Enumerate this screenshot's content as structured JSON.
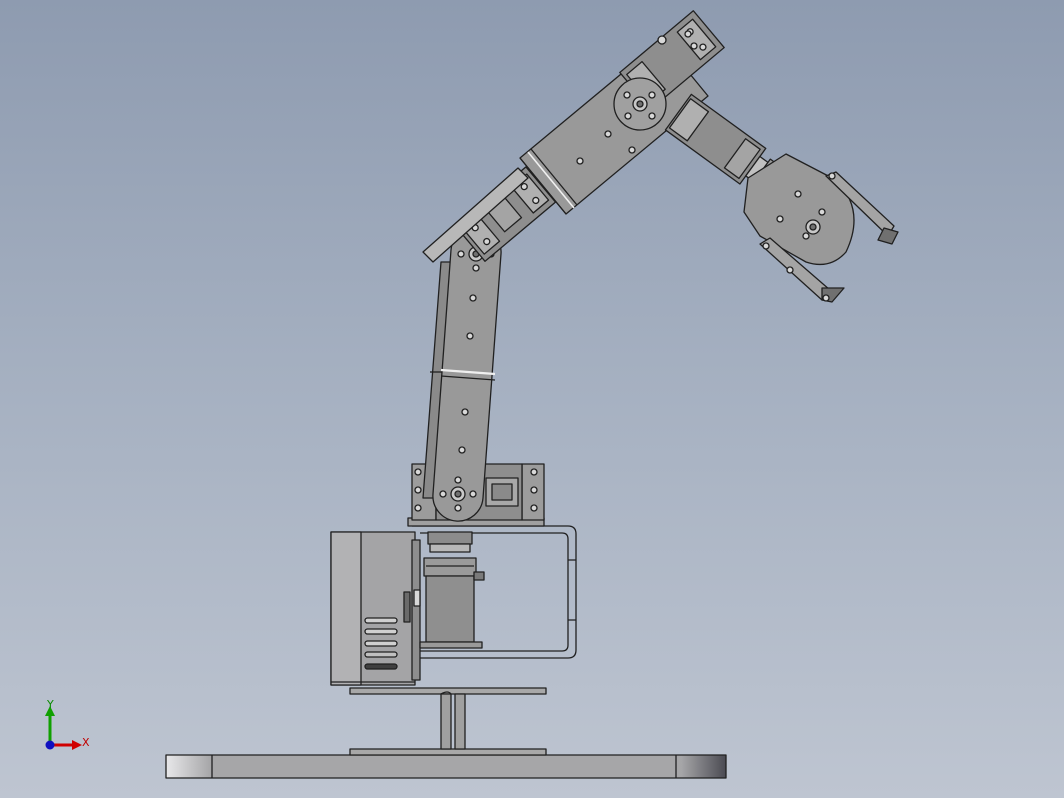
{
  "view": {
    "background_top": "#8e9bb0",
    "background_bottom": "#bec5d1",
    "model_fill": "#9a9a9a",
    "model_edge": "#202020"
  },
  "triad": {
    "x_label": "X",
    "y_label": "Y",
    "x_color": "#d00000",
    "y_color": "#10a000",
    "z_color": "#1010c0"
  }
}
